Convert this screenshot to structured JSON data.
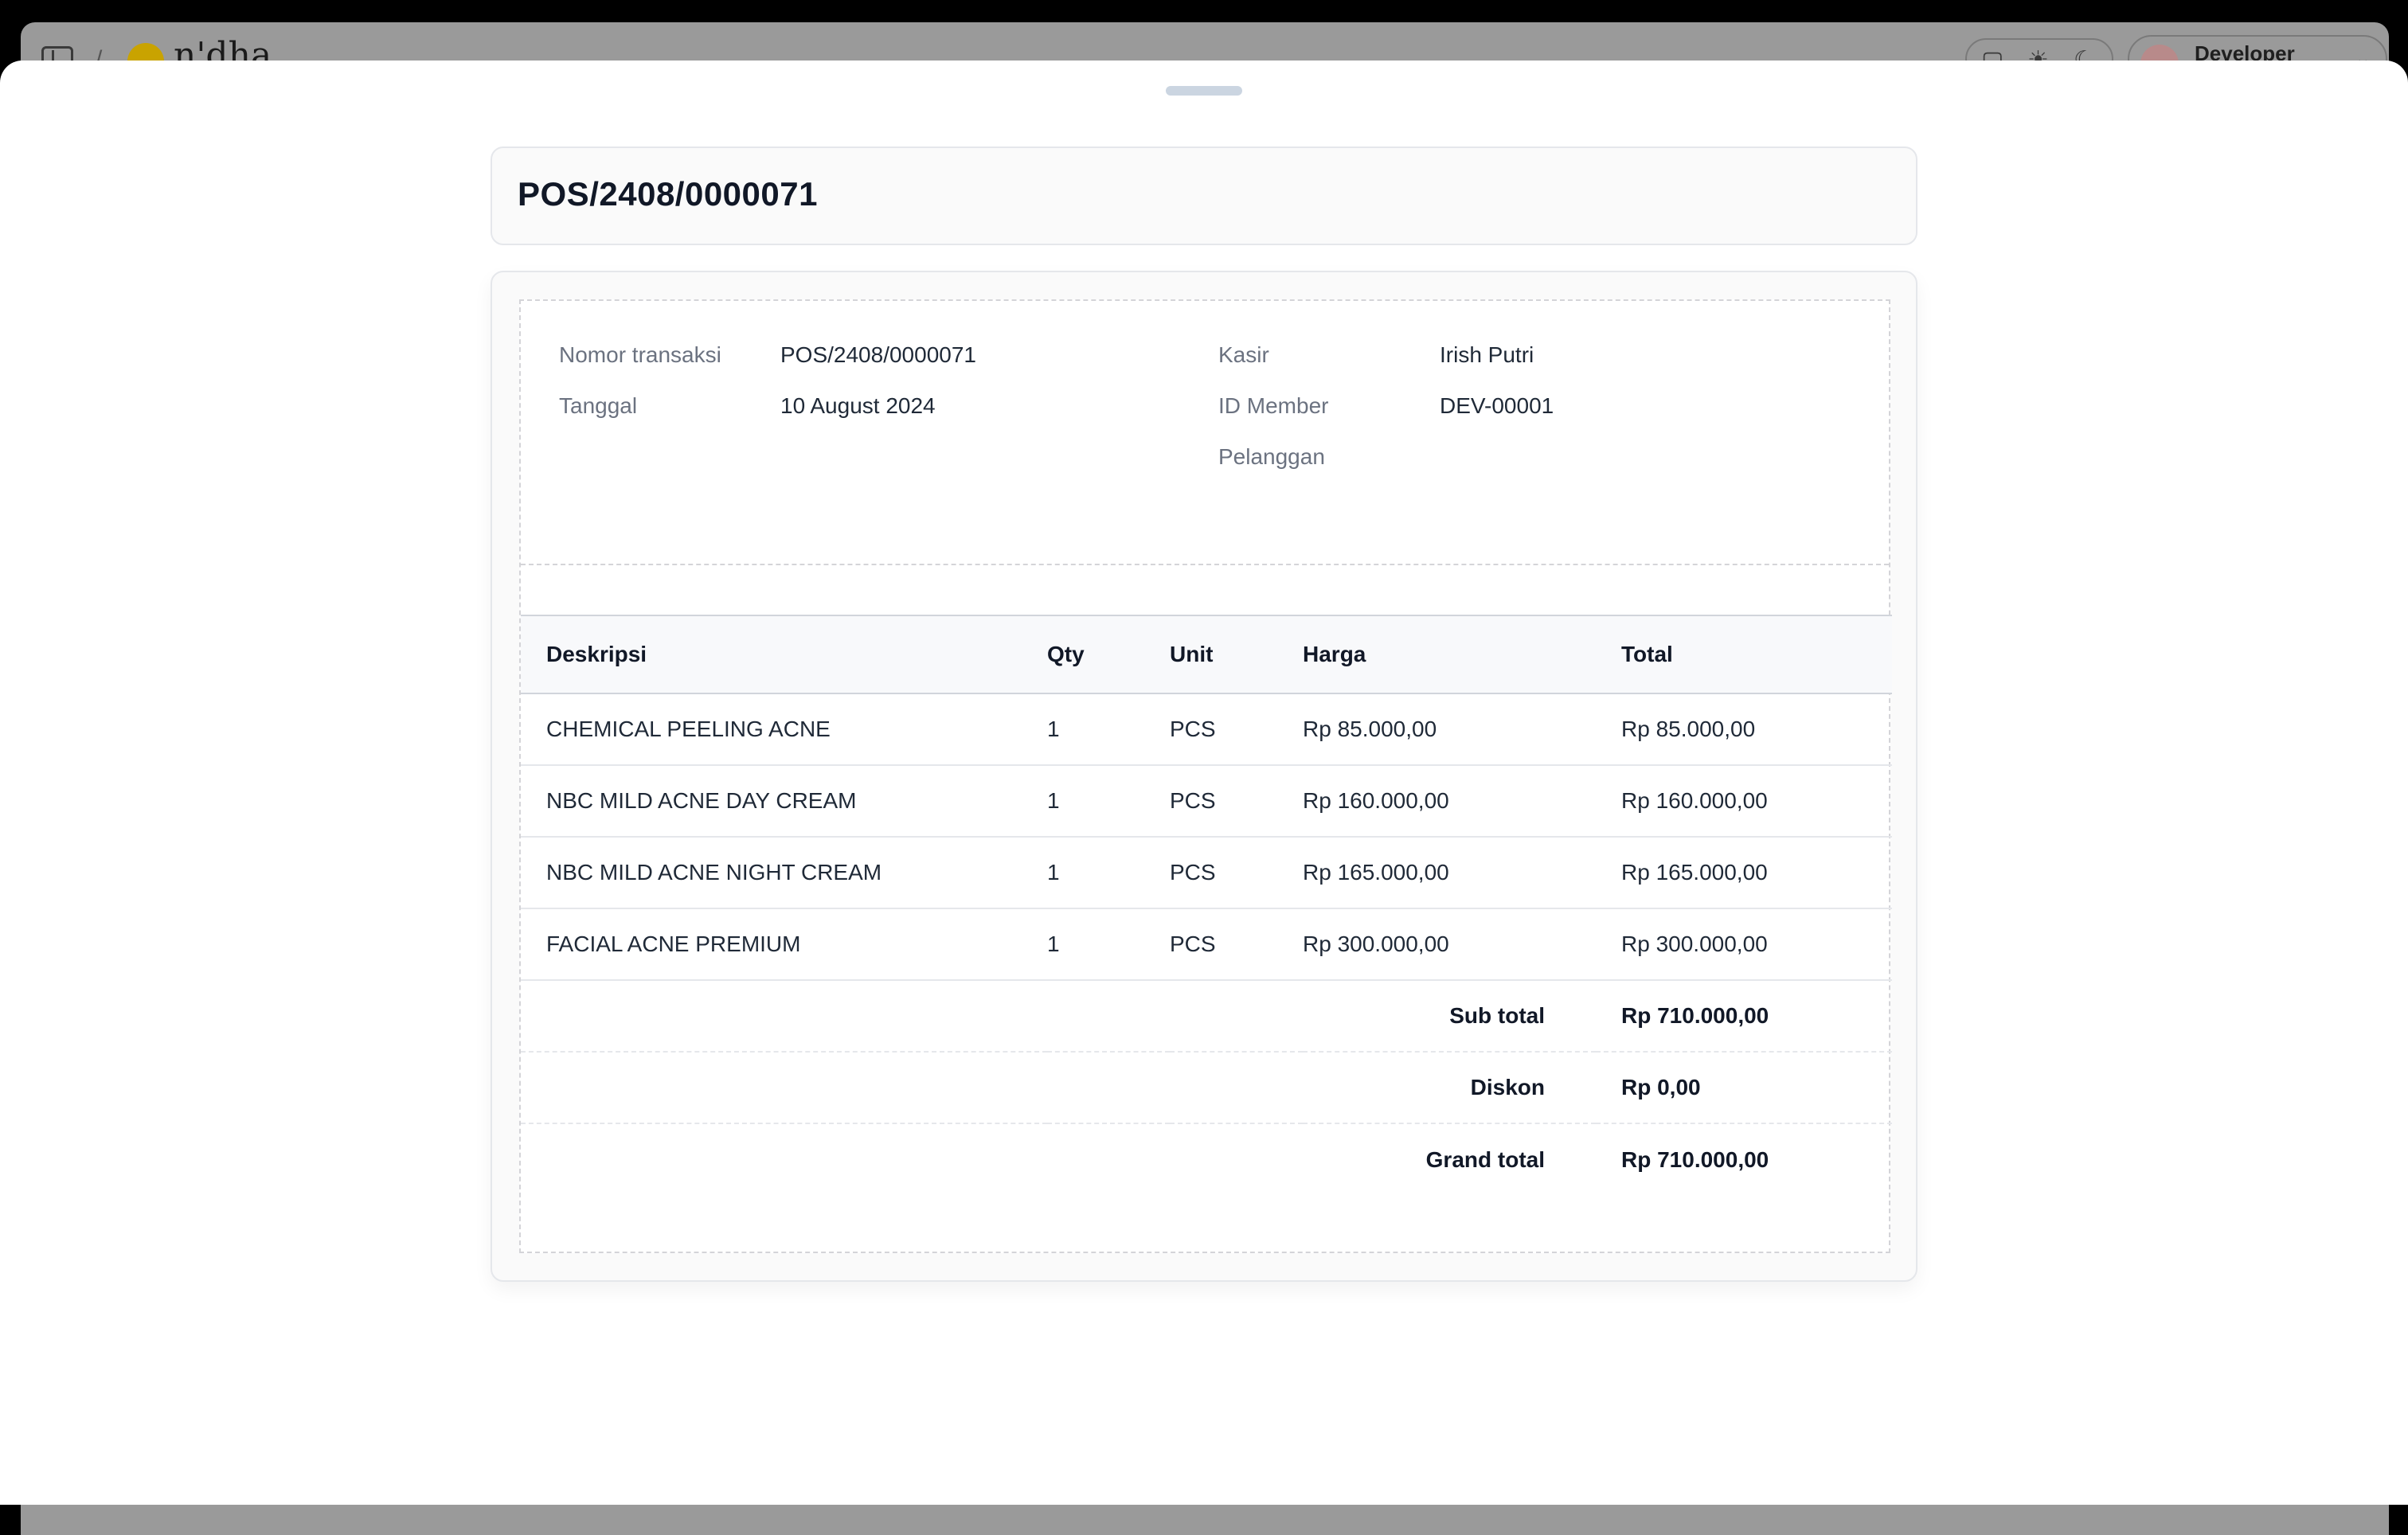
{
  "app": {
    "breadcrumb_separator": "/",
    "logo_text": "n'dha",
    "user_name": "Developer"
  },
  "transaction": {
    "title": "POS/2408/0000071"
  },
  "info": {
    "left": [
      {
        "label": "Nomor transaksi",
        "value": "POS/2408/0000071"
      },
      {
        "label": "Tanggal",
        "value": "10 August 2024"
      }
    ],
    "right": [
      {
        "label": "Kasir",
        "value": "Irish Putri"
      },
      {
        "label": "ID Member",
        "value": "DEV-00001"
      },
      {
        "label": "Pelanggan",
        "value": ""
      }
    ]
  },
  "table": {
    "headers": {
      "desc": "Deskripsi",
      "qty": "Qty",
      "unit": "Unit",
      "price": "Harga",
      "total": "Total"
    },
    "rows": [
      {
        "desc": "CHEMICAL PEELING ACNE",
        "qty": "1",
        "unit": "PCS",
        "price": "Rp 85.000,00",
        "total": "Rp 85.000,00"
      },
      {
        "desc": "NBC MILD ACNE DAY CREAM",
        "qty": "1",
        "unit": "PCS",
        "price": "Rp 160.000,00",
        "total": "Rp 160.000,00"
      },
      {
        "desc": "NBC MILD ACNE NIGHT CREAM",
        "qty": "1",
        "unit": "PCS",
        "price": "Rp 165.000,00",
        "total": "Rp 165.000,00"
      },
      {
        "desc": "FACIAL ACNE PREMIUM",
        "qty": "1",
        "unit": "PCS",
        "price": "Rp 300.000,00",
        "total": "Rp 300.000,00"
      }
    ],
    "summary": {
      "subtotal_label": "Sub total",
      "subtotal_value": "Rp 710.000,00",
      "discount_label": "Diskon",
      "discount_value": "Rp 0,00",
      "grand_label": "Grand total",
      "grand_value": "Rp 710.000,00"
    }
  }
}
